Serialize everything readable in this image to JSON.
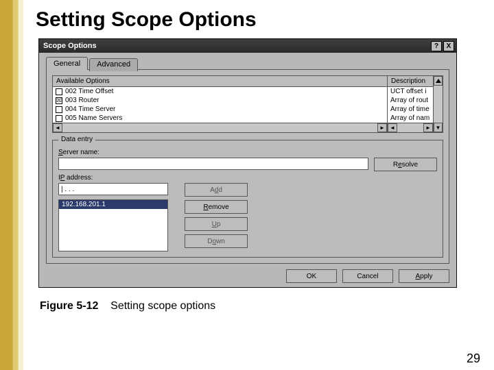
{
  "slide": {
    "title": "Setting Scope Options",
    "page_number": "29"
  },
  "figure": {
    "label": "Figure 5-12",
    "caption": "Setting scope options"
  },
  "dialog": {
    "title": "Scope Options",
    "help_btn": "?",
    "close_btn": "X",
    "tabs": {
      "general": "General",
      "advanced": "Advanced"
    },
    "columns": {
      "available": "Available Options",
      "description": "Description"
    },
    "options": [
      {
        "checked": false,
        "label": "002 Time Offset",
        "desc": "UCT offset i"
      },
      {
        "checked": true,
        "label": "003 Router",
        "desc": "Array of rout"
      },
      {
        "checked": false,
        "label": "004 Time Server",
        "desc": "Array of time"
      },
      {
        "checked": false,
        "label": "005 Name Servers",
        "desc": "Array of nam"
      }
    ],
    "data_entry": {
      "legend": "Data entry",
      "server_name_label": "Server name:",
      "server_name_value": "",
      "resolve_btn": "Resolve",
      "ip_label": "IP address:",
      "ip_value": "|   .     .     .",
      "add_btn": "Add",
      "remove_btn": "Remove",
      "up_btn": "Up",
      "down_btn": "Down",
      "list_selected": "192.168.201.1"
    },
    "buttons": {
      "ok": "OK",
      "cancel": "Cancel",
      "apply": "Apply"
    }
  }
}
